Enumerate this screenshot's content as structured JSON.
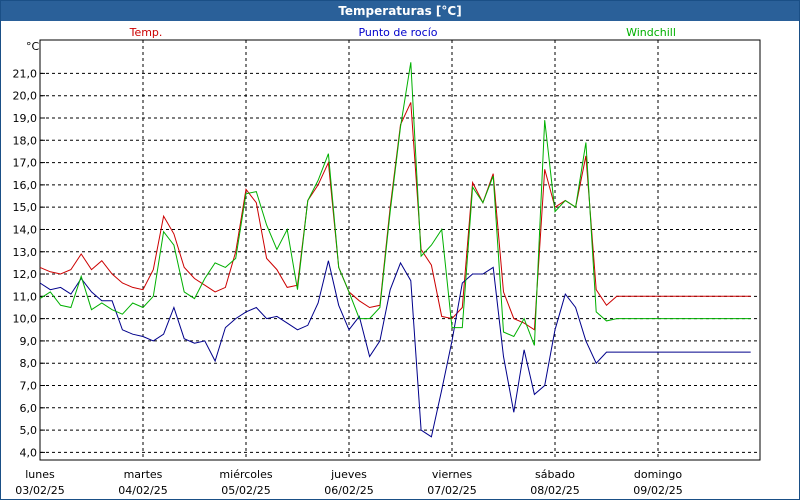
{
  "window": {
    "title": "Temperaturas [°C]"
  },
  "chart_data": {
    "type": "line",
    "title": "Temperaturas [°C]",
    "ylabel": "°C",
    "xlabel": "",
    "ylim": [
      4.0,
      22.5
    ],
    "y_ticks": [
      4.0,
      5.0,
      6.0,
      7.0,
      8.0,
      9.0,
      10.0,
      11.0,
      12.0,
      13.0,
      14.0,
      15.0,
      16.0,
      17.0,
      18.0,
      19.0,
      20.0,
      21.0
    ],
    "y_tick_labels": [
      "4,0",
      "5,0",
      "6,0",
      "7,0",
      "8,0",
      "9,0",
      "10,0",
      "11,0",
      "12,0",
      "13,0",
      "14,0",
      "15,0",
      "16,0",
      "17,0",
      "18,0",
      "19,0",
      "20,0",
      "21,0"
    ],
    "x_range_days": [
      0,
      7.05
    ],
    "x_ticks": [
      {
        "day": 0,
        "weekday": "lunes",
        "date": "03/02/25"
      },
      {
        "day": 1,
        "weekday": "martes",
        "date": "04/02/25"
      },
      {
        "day": 2,
        "weekday": "miércoles",
        "date": "05/02/25"
      },
      {
        "day": 3,
        "weekday": "jueves",
        "date": "06/02/25"
      },
      {
        "day": 4,
        "weekday": "viernes",
        "date": "07/02/25"
      },
      {
        "day": 5,
        "weekday": "sábado",
        "date": "08/02/25"
      },
      {
        "day": 6,
        "weekday": "domingo",
        "date": "09/02/25"
      }
    ],
    "grid": true,
    "legend_position": "top",
    "series": [
      {
        "name": "Temp.",
        "color": "#cc0000",
        "x": [
          0,
          0.1,
          0.2,
          0.3,
          0.4,
          0.5,
          0.6,
          0.7,
          0.8,
          0.9,
          1.0,
          1.1,
          1.2,
          1.3,
          1.4,
          1.5,
          1.6,
          1.7,
          1.8,
          1.9,
          2.0,
          2.1,
          2.2,
          2.3,
          2.4,
          2.5,
          2.6,
          2.7,
          2.8,
          2.9,
          3.0,
          3.1,
          3.2,
          3.3,
          3.4,
          3.5,
          3.6,
          3.7,
          3.8,
          3.9,
          4.0,
          4.1,
          4.2,
          4.3,
          4.4,
          4.5,
          4.6,
          4.7,
          4.8,
          4.9,
          5.0,
          5.1,
          5.2,
          5.3,
          5.4,
          5.5,
          5.6,
          5.7,
          5.8,
          5.9,
          6.0,
          6.1,
          6.2,
          6.3,
          6.4,
          6.5,
          6.6,
          6.7,
          6.8,
          6.9,
          7.0,
          7.05
        ],
        "values": [
          12.3,
          12.1,
          12.0,
          12.2,
          12.9,
          12.2,
          12.6,
          12.0,
          11.6,
          11.4,
          11.3,
          12.2,
          14.6,
          13.8,
          12.3,
          11.8,
          11.5,
          11.2,
          11.4,
          13.0,
          15.8,
          15.2,
          12.7,
          12.2,
          11.4,
          11.5,
          15.3,
          16.0,
          17.0,
          12.3,
          11.2,
          10.8,
          10.5,
          10.6,
          15.0,
          18.7,
          19.7,
          13.1,
          12.4,
          10.1,
          10.0,
          10.5,
          16.1,
          15.2,
          16.5,
          11.2,
          10.0,
          9.8,
          9.5,
          16.7,
          15.0,
          15.3,
          15.0,
          17.3,
          11.3,
          10.6,
          11.0,
          11.0,
          11.0,
          11.0,
          11.0,
          11.0,
          11.0,
          11.0,
          11.0,
          11.0,
          11.0,
          11.0,
          11.0,
          11.0,
          11.0,
          11.0
        ]
      },
      {
        "name": "Punto de rocío",
        "color": "#00008b",
        "x": [
          0,
          0.1,
          0.2,
          0.3,
          0.4,
          0.5,
          0.6,
          0.7,
          0.8,
          0.9,
          1.0,
          1.1,
          1.2,
          1.3,
          1.4,
          1.5,
          1.6,
          1.7,
          1.8,
          1.9,
          2.0,
          2.1,
          2.2,
          2.3,
          2.4,
          2.5,
          2.6,
          2.7,
          2.8,
          2.9,
          3.0,
          3.1,
          3.2,
          3.3,
          3.4,
          3.5,
          3.6,
          3.7,
          3.8,
          3.9,
          4.0,
          4.1,
          4.2,
          4.3,
          4.4,
          4.5,
          4.6,
          4.7,
          4.8,
          4.9,
          5.0,
          5.1,
          5.2,
          5.3,
          5.4,
          5.5,
          5.6,
          5.7,
          5.8,
          5.9,
          6.0,
          6.1,
          6.2,
          6.3,
          6.4,
          6.5,
          6.6,
          6.7,
          6.8,
          6.9,
          7.0,
          7.05
        ],
        "values": [
          11.6,
          11.3,
          11.4,
          11.1,
          11.8,
          11.2,
          10.8,
          10.8,
          9.5,
          9.3,
          9.2,
          9.0,
          9.3,
          10.5,
          9.1,
          8.9,
          9.0,
          8.1,
          9.6,
          10.0,
          10.3,
          10.5,
          10.0,
          10.1,
          9.8,
          9.5,
          9.7,
          10.7,
          12.6,
          10.6,
          9.5,
          10.1,
          8.3,
          9.0,
          11.3,
          12.5,
          11.7,
          5.0,
          4.7,
          6.8,
          9.0,
          11.6,
          12.0,
          12.0,
          12.3,
          8.3,
          5.8,
          8.6,
          6.6,
          7.0,
          9.5,
          11.1,
          10.5,
          9.0,
          8.0,
          8.5,
          8.5,
          8.5,
          8.5,
          8.5,
          8.5,
          8.5,
          8.5,
          8.5,
          8.5,
          8.5,
          8.5,
          8.5,
          8.5,
          8.5,
          8.5,
          8.5
        ]
      },
      {
        "name": "Windchill",
        "color": "#00b000",
        "x": [
          0,
          0.1,
          0.2,
          0.3,
          0.4,
          0.5,
          0.6,
          0.7,
          0.8,
          0.9,
          1.0,
          1.1,
          1.2,
          1.3,
          1.4,
          1.5,
          1.6,
          1.7,
          1.8,
          1.9,
          2.0,
          2.1,
          2.2,
          2.3,
          2.4,
          2.5,
          2.6,
          2.7,
          2.8,
          2.9,
          3.0,
          3.1,
          3.2,
          3.3,
          3.4,
          3.5,
          3.6,
          3.7,
          3.8,
          3.9,
          4.0,
          4.1,
          4.2,
          4.3,
          4.4,
          4.5,
          4.6,
          4.7,
          4.8,
          4.9,
          5.0,
          5.1,
          5.2,
          5.3,
          5.4,
          5.5,
          5.6,
          5.7,
          5.8,
          5.9,
          6.0,
          6.1,
          6.2,
          6.3,
          6.4,
          6.5,
          6.6,
          6.7,
          6.8,
          6.9,
          7.0,
          7.05
        ],
        "values": [
          10.9,
          11.2,
          10.6,
          10.5,
          11.9,
          10.4,
          10.7,
          10.4,
          10.2,
          10.7,
          10.5,
          11.0,
          13.9,
          13.3,
          11.2,
          10.9,
          11.8,
          12.5,
          12.3,
          12.7,
          15.6,
          15.7,
          14.2,
          13.1,
          14.0,
          11.3,
          15.3,
          16.2,
          17.4,
          12.3,
          11.2,
          10.0,
          10.0,
          10.5,
          14.8,
          18.6,
          21.5,
          12.8,
          13.3,
          14.0,
          9.6,
          9.6,
          15.9,
          15.2,
          16.4,
          9.4,
          9.2,
          10.0,
          8.8,
          18.9,
          14.8,
          15.3,
          15.0,
          17.9,
          10.3,
          9.9,
          10.0,
          10.0,
          10.0,
          10.0,
          10.0,
          10.0,
          10.0,
          10.0,
          10.0,
          10.0,
          10.0,
          10.0,
          10.0,
          10.0,
          10.0,
          10.0
        ]
      }
    ]
  }
}
